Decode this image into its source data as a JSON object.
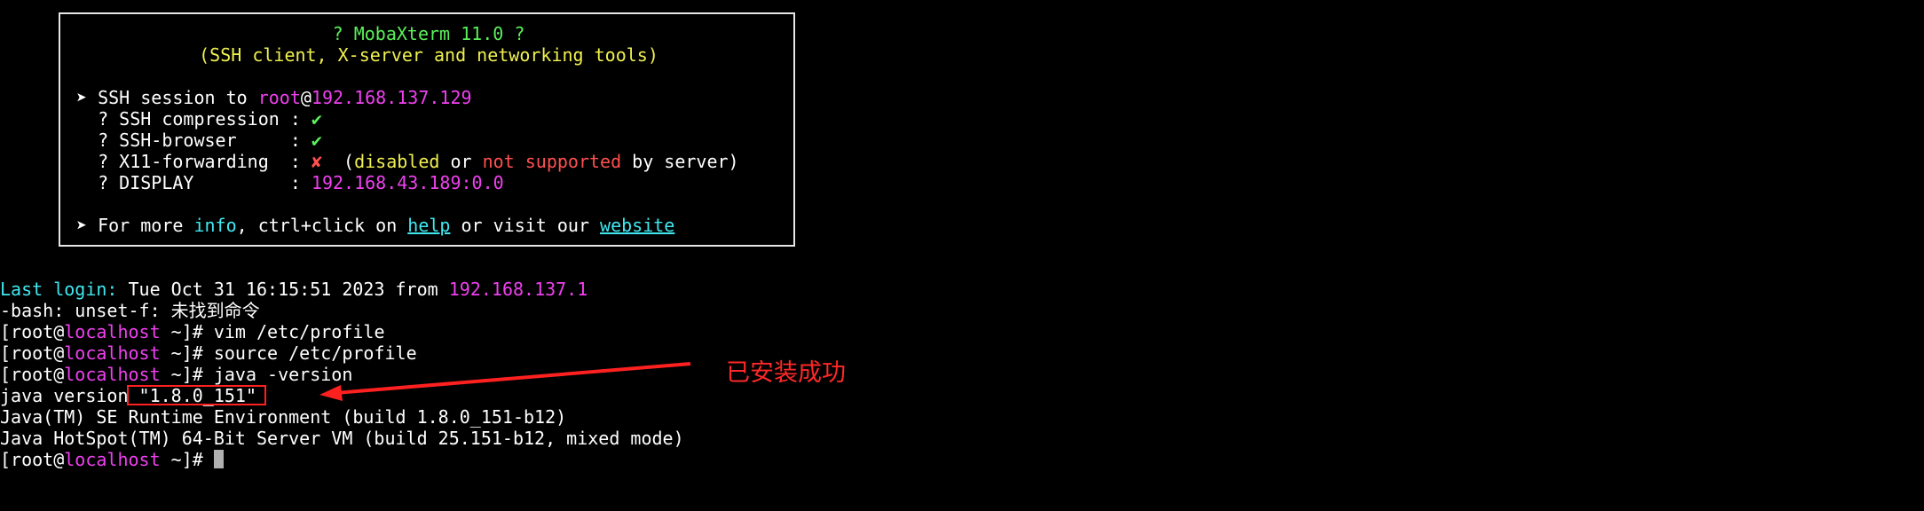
{
  "banner": {
    "title": "? MobaXterm 11.0 ?",
    "subtitle": "(SSH client, X-server and networking tools)",
    "session_prefix": "➤ SSH session to ",
    "session_user": "root",
    "session_at": "@",
    "session_host": "192.168.137.129",
    "rows": [
      {
        "label": "  ? SSH compression : ",
        "mark": "✔"
      },
      {
        "label": "  ? SSH-browser     : ",
        "mark": "✔"
      }
    ],
    "x11_label": "  ? X11-forwarding  : ",
    "x11_mark": "✘",
    "x11_open": "  (",
    "x11_disabled": "disabled",
    "x11_or": " or ",
    "x11_not_supported": "not supported",
    "x11_close": " by server)",
    "display_label": "  ? DISPLAY         : ",
    "display_value": "192.168.43.189:0.0",
    "more_prefix": "➤ For more ",
    "more_info": "info",
    "more_mid": ", ctrl+click on ",
    "more_help": "help",
    "more_mid2": " or visit our ",
    "more_website": "website"
  },
  "terminal": {
    "last_login_label": "Last login:",
    "last_login_text": " Tue Oct 31 16:15:51 2023 from ",
    "last_login_ip": "192.168.137.1",
    "bash_error": "-bash: unset-f: 未找到命令",
    "prompt_open": "[root@",
    "prompt_host": "localhost",
    "prompt_close": " ~]# ",
    "cmd1": "vim /etc/profile",
    "cmd2": "source /etc/profile",
    "cmd3": "java -version",
    "java_version": "java version \"1.8.0_151\"",
    "java_runtime": "Java(TM) SE Runtime Environment (build 1.8.0_151-b12)",
    "java_vm": "Java HotSpot(TM) 64-Bit Server VM (build 25.151-b12, mixed mode)"
  },
  "annotation": {
    "text": "已安装成功",
    "color": "#ff2828"
  }
}
